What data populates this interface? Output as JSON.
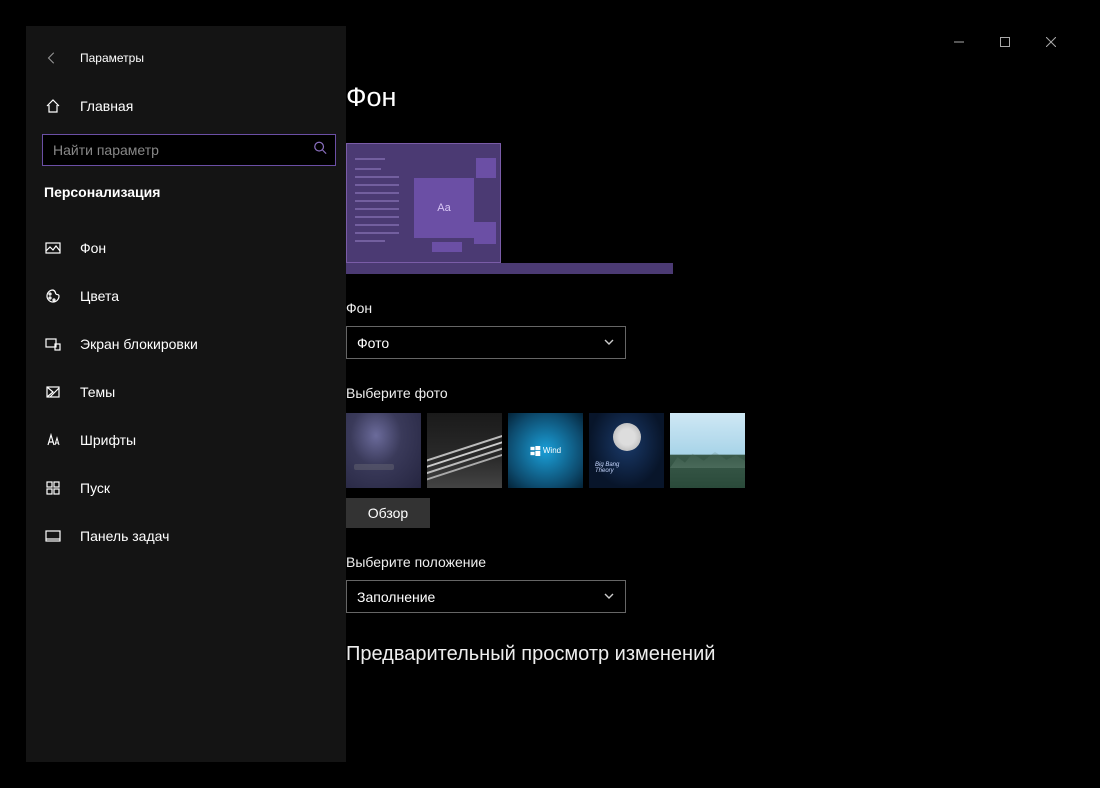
{
  "header": {
    "title": "Параметры"
  },
  "home": {
    "label": "Главная"
  },
  "search": {
    "placeholder": "Найти параметр"
  },
  "section": {
    "label": "Персонализация"
  },
  "sidebar": {
    "items": [
      {
        "label": "Фон"
      },
      {
        "label": "Цвета"
      },
      {
        "label": "Экран блокировки"
      },
      {
        "label": "Темы"
      },
      {
        "label": "Шрифты"
      },
      {
        "label": "Пуск"
      },
      {
        "label": "Панель задач"
      }
    ]
  },
  "page": {
    "title": "Фон",
    "preview_sample": "Aa",
    "bg_label": "Фон",
    "bg_select_value": "Фото",
    "choose_photo_label": "Выберите фото",
    "browse_label": "Обзор",
    "position_label": "Выберите положение",
    "position_select_value": "Заполнение",
    "preview_changes_label": "Предварительный просмотр изменений"
  },
  "thumb3_text": "Wind"
}
